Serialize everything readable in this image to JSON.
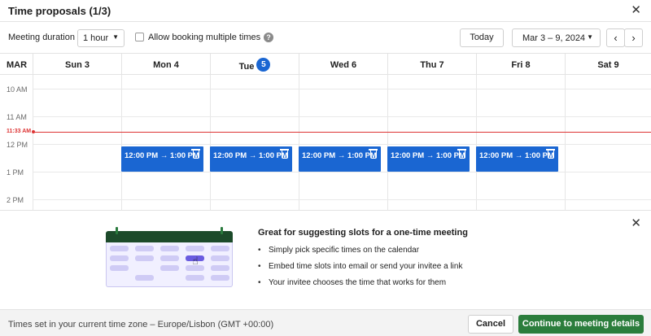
{
  "header": {
    "title": "Time proposals (1/3)",
    "close_icon": "close-icon"
  },
  "toolbar": {
    "duration_label": "Meeting duration",
    "duration_value": "1 hour",
    "allow_multiple_label": "Allow booking multiple times",
    "allow_multiple_checked": false,
    "today_label": "Today",
    "date_range": "Mar 3 – 9, 2024",
    "prev_icon": "chevron-left-icon",
    "next_icon": "chevron-right-icon"
  },
  "calendar": {
    "month": "MAR",
    "days": [
      {
        "label": "Sun 3",
        "today": false
      },
      {
        "label": "Mon 4",
        "today": false
      },
      {
        "label": "Tue",
        "today": true,
        "day_number": "5"
      },
      {
        "label": "Wed 6",
        "today": false
      },
      {
        "label": "Thu 7",
        "today": false
      },
      {
        "label": "Fri 8",
        "today": false
      },
      {
        "label": "Sat 9",
        "today": false
      }
    ],
    "time_labels": [
      "10 AM",
      "11 AM",
      "12 PM",
      "1 PM",
      "2 PM"
    ],
    "current_time": "11:33 AM",
    "slots": [
      {
        "day": "Mon 4",
        "label": "12:00 PM → 1:00 PM"
      },
      {
        "day": "Tue 5",
        "label": "12:00 PM → 1:00 PM"
      },
      {
        "day": "Wed 6",
        "label": "12:00 PM → 1:00 PM"
      },
      {
        "day": "Thu 7",
        "label": "12:00 PM → 1:00 PM"
      },
      {
        "day": "Fri 8",
        "label": "12:00 PM → 1:00 PM"
      }
    ],
    "accent_color": "#1a66d2",
    "now_color": "#dd3333"
  },
  "promo": {
    "title": "Great for suggesting slots for a one-time meeting",
    "bullets": [
      "Simply pick specific times on the calendar",
      "Embed time slots into email or send your invitee a link",
      "Your invitee chooses the time that works for them"
    ]
  },
  "footer": {
    "timezone_text": "Times set in your current time zone – Europe/Lisbon (GMT +00:00)",
    "cancel_label": "Cancel",
    "continue_label": "Continue to meeting details",
    "continue_color": "#2b7d3c"
  }
}
